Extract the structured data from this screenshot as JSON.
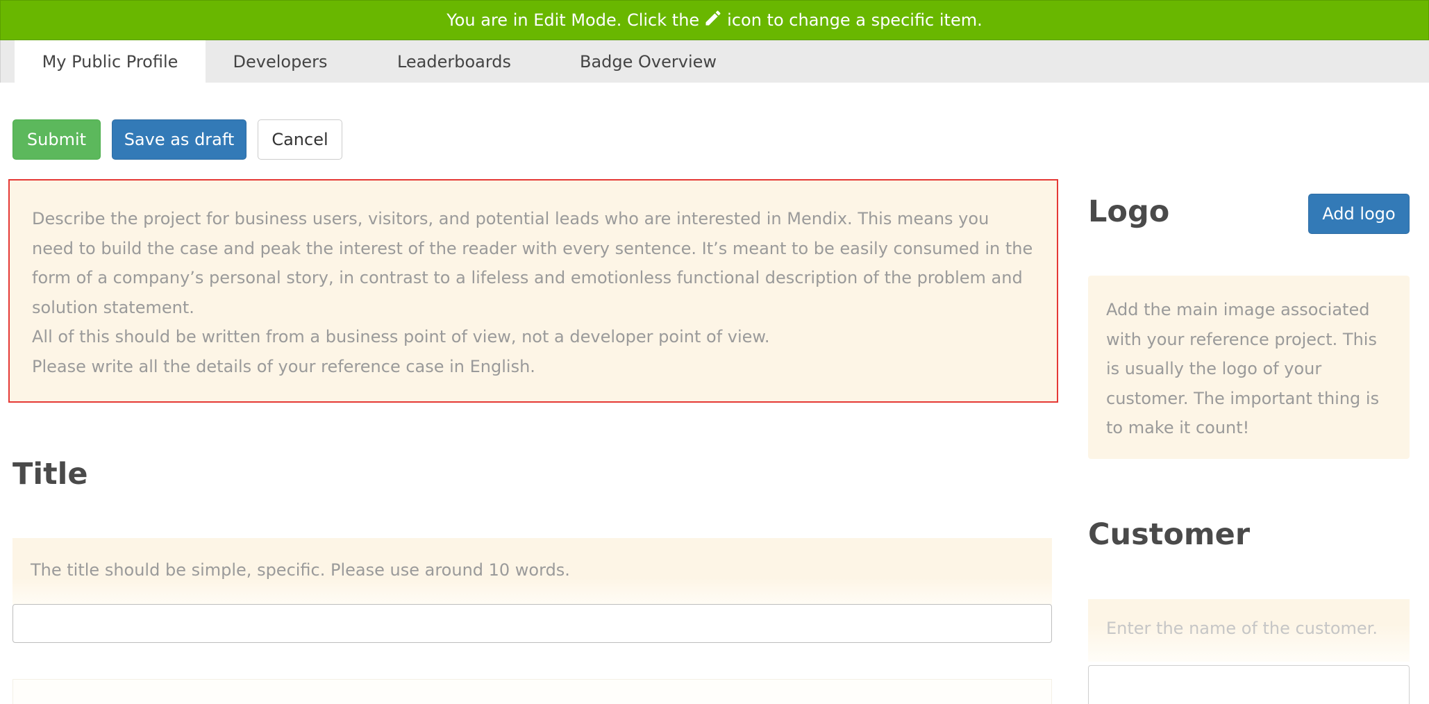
{
  "banner": {
    "text_before": "You are in Edit Mode. Click the",
    "icon": "pencil-icon",
    "text_after": "icon to change a specific item."
  },
  "tabs": [
    {
      "label": "My Public Profile",
      "active": true
    },
    {
      "label": "Developers",
      "active": false
    },
    {
      "label": "Leaderboards",
      "active": false
    },
    {
      "label": "Badge Overview",
      "active": false
    }
  ],
  "toolbar": {
    "submit_label": "Submit",
    "draft_label": "Save as draft",
    "cancel_label": "Cancel"
  },
  "description": {
    "paragraph1": "Describe the project for business users, visitors, and potential leads who are interested in Mendix. This means you need to build the case and peak the interest of the reader with every sentence. It’s meant to be easily consumed in the form of a company’s personal story, in contrast to a lifeless and emotionless functional description of the problem and solution statement.",
    "paragraph2": "All of this should be written from a business point of view, not a developer point of view.",
    "paragraph3": "Please write all the details of your reference case in English."
  },
  "title_section": {
    "heading": "Title",
    "hint": "The title should be simple, specific. Please use around 10 words.",
    "value": ""
  },
  "logo_section": {
    "heading": "Logo",
    "add_label": "Add logo",
    "hint": "Add the main image associated with your reference project. This is usually the logo of your customer. The important thing is to make it count!"
  },
  "customer_section": {
    "heading": "Customer",
    "hint": "Enter the name of the customer.",
    "value": ""
  },
  "colors": {
    "banner": "#69b700",
    "primary": "#337ab7",
    "success": "#5cb85c",
    "hint_bg": "#fdf5e6",
    "highlight_border": "#e53935"
  }
}
